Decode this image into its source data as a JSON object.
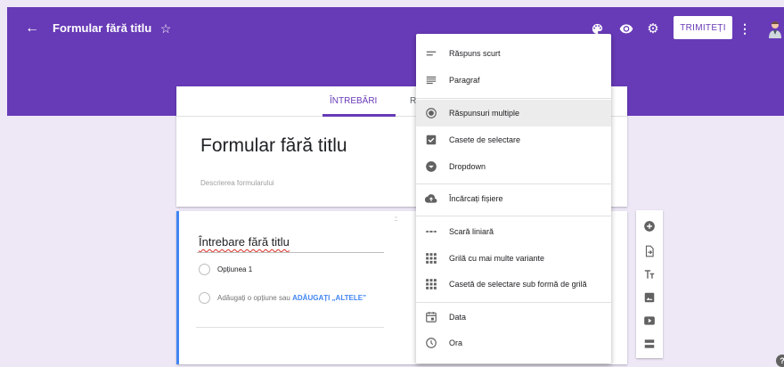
{
  "header": {
    "title": "Formular fără titlu",
    "send_label": "TRIMITEȚI",
    "back_glyph": "←",
    "star_glyph": "☆",
    "more_glyph": "⋮",
    "gear_glyph": "⚙",
    "icons": [
      "back-arrow-icon",
      "star-icon",
      "palette-icon",
      "eye-icon",
      "gear-icon",
      "more-vert-icon",
      "avatar"
    ]
  },
  "tabs": [
    {
      "label": "ÎNTREBĂRI",
      "active": true
    },
    {
      "label": "R",
      "active": false
    }
  ],
  "form": {
    "title": "Formular fără titlu",
    "description_placeholder": "Descrierea formularului"
  },
  "question": {
    "drag_handle": ":::",
    "title": "Întrebare fără titlu",
    "option_1": "Opțiunea 1",
    "add_option": "Adăugați o opțiune",
    "or": "sau",
    "add_other": "ADĂUGAȚI „ALTELE”"
  },
  "menu": {
    "items": [
      {
        "label": "Răspuns scurt",
        "icon": "short-answer-icon"
      },
      {
        "label": "Paragraf",
        "icon": "paragraph-icon"
      },
      {
        "label": "Răspunsuri multiple",
        "icon": "radio-icon",
        "selected": true
      },
      {
        "label": "Casete de selectare",
        "icon": "checkbox-icon"
      },
      {
        "label": "Dropdown",
        "icon": "dropdown-icon"
      },
      {
        "label": "Încărcați fișiere",
        "icon": "cloud-upload-icon"
      },
      {
        "label": "Scară liniară",
        "icon": "linear-scale-icon"
      },
      {
        "label": "Grilă cu mai multe variante",
        "icon": "grid-icon"
      },
      {
        "label": "Casetă de selectare sub formă de grilă",
        "icon": "checkbox-grid-icon"
      },
      {
        "label": "Data",
        "icon": "calendar-icon"
      },
      {
        "label": "Ora",
        "icon": "clock-icon"
      }
    ]
  },
  "side_tools": [
    "add-question-icon",
    "import-questions-icon",
    "add-title-icon",
    "add-image-icon",
    "add-video-icon",
    "add-section-icon"
  ],
  "help_glyph": "?",
  "colors": {
    "primary": "#673ab7",
    "background": "#ede7f6",
    "accent_blue": "#4285f4",
    "icon_grey": "#616161"
  }
}
